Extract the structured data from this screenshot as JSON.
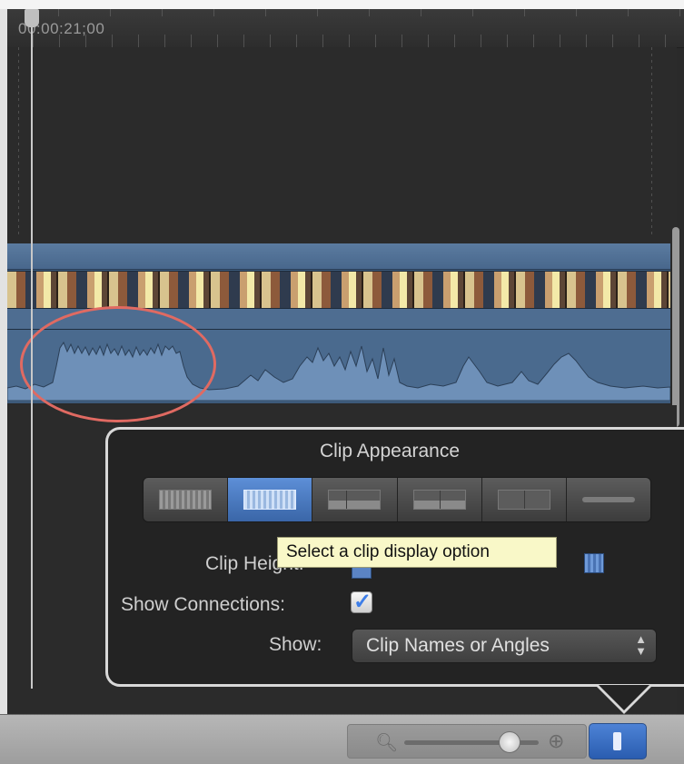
{
  "timeline": {
    "timecode": "00:00:21;00"
  },
  "popover": {
    "title": "Clip Appearance",
    "display_options": [
      "waveform-large",
      "waveform-filmstrip",
      "filmstrip-waveform",
      "filmstrip-large",
      "filmstrip-only",
      "name-only"
    ],
    "selected_option_index": 1,
    "tooltip": "Select a clip display option",
    "clip_height_label": "Clip Height:",
    "show_connections_label": "Show Connections:",
    "show_connections_checked": true,
    "show_label": "Show:",
    "show_value": "Clip Names or Angles"
  },
  "colors": {
    "clip": "#4a6a8e",
    "accent": "#3a66a8",
    "tooltip_bg": "#f9f8c8",
    "annotation": "#e06a62"
  }
}
